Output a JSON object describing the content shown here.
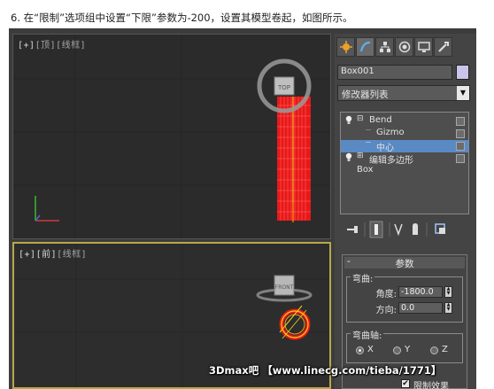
{
  "caption": "6. 在“限制”选项组中设置“下限”参数为-200，设置其模型卷起，如图所示。",
  "viewports": {
    "top": {
      "label_bracket1": "[+]",
      "label_view": "[顶]",
      "label_mode": "[线框]"
    },
    "front": {
      "label_bracket1": "[+]",
      "label_view": "[前]",
      "label_mode": "[线框]"
    },
    "top_cube_text": "TOP",
    "front_cube_text": "FRONT"
  },
  "command_panel": {
    "tabs": [
      "create-icon",
      "modify-icon",
      "hierarchy-icon",
      "motion-icon",
      "display-icon",
      "utilities-icon"
    ],
    "object_name": "Box001",
    "object_color": "#c8c4ea",
    "modifier_list": "修改器列表",
    "stack": [
      {
        "label": "Bend",
        "level": 0,
        "expand": "⊟",
        "bulb": true
      },
      {
        "label": "Gizmo",
        "level": 1
      },
      {
        "label": "中心",
        "level": 1,
        "selected": true
      },
      {
        "label": "编辑多边形",
        "level": 0,
        "expand": "⊞",
        "bulb": true
      },
      {
        "label": "Box",
        "level": 0
      }
    ],
    "rollout": {
      "minus": "-",
      "title": "参数",
      "bend_group": "弯曲:",
      "angle_label": "角度:",
      "angle_value": "-1800.0",
      "direction_label": "方向:",
      "direction_value": "0.0",
      "axis_group": "弯曲轴:",
      "axes": [
        "X",
        "Y",
        "Z"
      ],
      "selected_axis": "X",
      "limit_effect": "限制效果"
    }
  },
  "watermark": "3Dmax吧 【www.linecg.com/tieba/1771】",
  "colors": {
    "viewport_bg": "#2b2b2b",
    "active_border": "#b9a84a",
    "selection": "#5a8ac4",
    "object_red": "#e81818",
    "bend_yellow": "#f2d21a"
  }
}
